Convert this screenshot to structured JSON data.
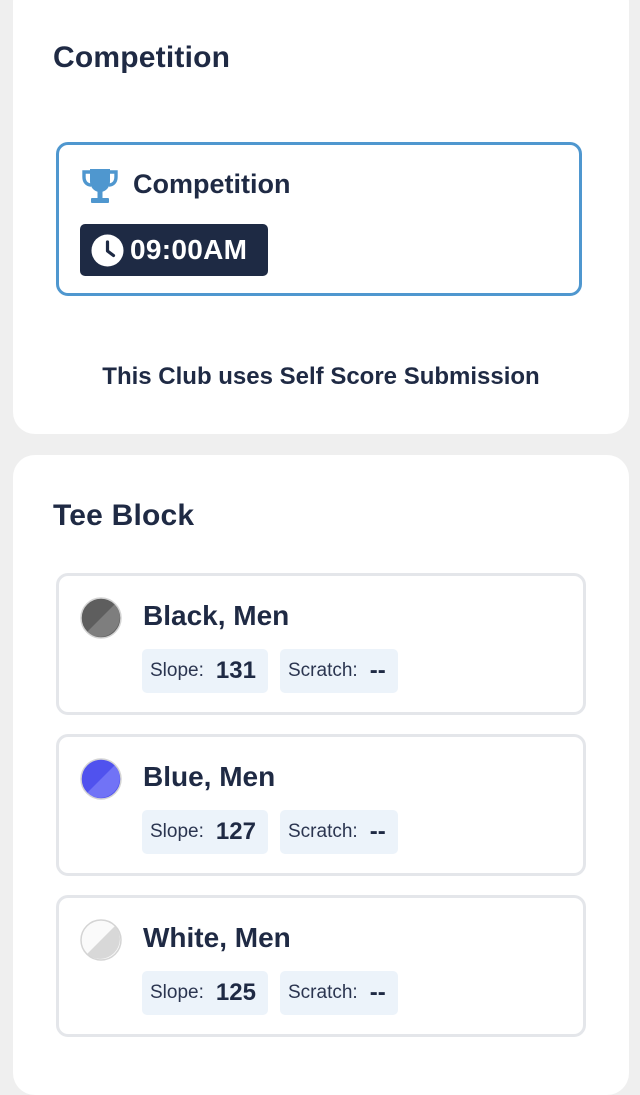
{
  "competition_section": {
    "title": "Competition",
    "event": {
      "icon": "trophy-icon",
      "name": "Competition",
      "time_icon": "clock-icon",
      "time": "09:00AM"
    },
    "note": "This Club uses Self Score Submission"
  },
  "tee_section": {
    "title": "Tee Block",
    "items": [
      {
        "name": "Black, Men",
        "color": "#6e6e6e",
        "slope_label": "Slope:",
        "slope": "131",
        "scratch_label": "Scratch:",
        "scratch": "--"
      },
      {
        "name": "Blue, Men",
        "color": "#5b5cf0",
        "slope_label": "Slope:",
        "slope": "127",
        "scratch_label": "Scratch:",
        "scratch": "--"
      },
      {
        "name": "White, Men",
        "color": "#f2f2f2",
        "slope_label": "Slope:",
        "slope": "125",
        "scratch_label": "Scratch:",
        "scratch": "--"
      }
    ]
  },
  "colors": {
    "accent_border": "#4f97cf",
    "dark_badge": "#1e2a44",
    "pill_bg": "#ecf3fa",
    "trophy": "#4f97cf"
  }
}
